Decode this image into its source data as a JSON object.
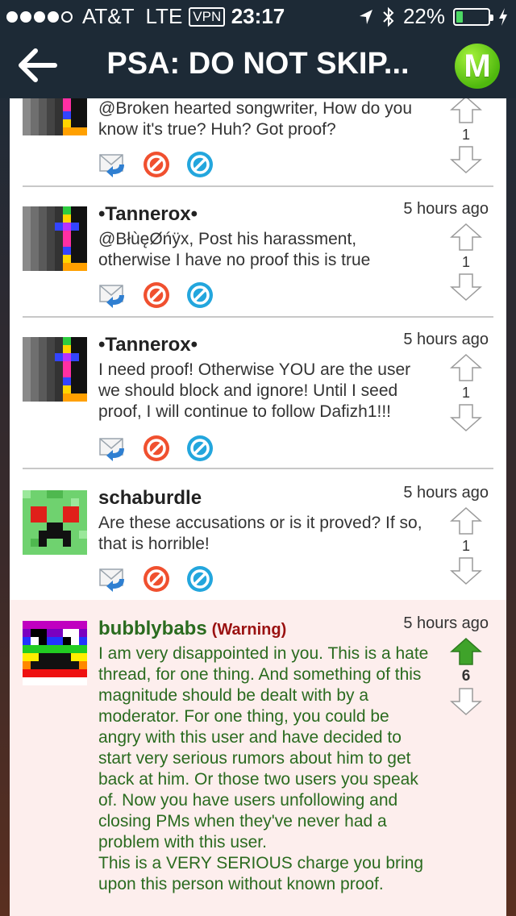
{
  "status_bar": {
    "carrier": "AT&T",
    "network": "LTE",
    "vpn": "VPN",
    "time": "23:17",
    "battery": "22%",
    "battery_level": 0.22
  },
  "nav": {
    "title": "PSA: DO NOT SKIP...",
    "logo_letter": "M"
  },
  "colors": {
    "bar": "#1d2a36",
    "upvote_active": "#3fa32a",
    "warning_bg": "#fdeeed",
    "green_text": "#2a6b1f",
    "warning_label": "#9a1111"
  },
  "comments": [
    {
      "username": "",
      "time": "",
      "text": "@Broken hearted songwriter, How do you know it's true? Huh? Got proof?",
      "votes": "1",
      "avatar": "gray-cross"
    },
    {
      "username": "•Tannerox•",
      "time": "5 hours ago",
      "text": "@BłùęØńÿx, Post his harassment, otherwise I have no proof this is true",
      "votes": "1",
      "avatar": "gray-cross"
    },
    {
      "username": "•Tannerox•",
      "time": "5 hours ago",
      "text": "I need proof! Otherwise YOU are the user we should block and ignore! Until I seed proof, I will continue to follow Dafizh1!!!",
      "votes": "1",
      "avatar": "gray-cross"
    },
    {
      "username": "schaburdle",
      "time": "5 hours ago",
      "text": "Are these accusations or is it proved? If so, that is horrible!",
      "votes": "1",
      "avatar": "creeper"
    },
    {
      "username": "bubblybabs",
      "warning": "(Warning)",
      "time": "5 hours ago",
      "text": "I am very disappointed in you. This is a hate thread, for one thing. And something of this magnitude should be dealt with by a moderator. For one thing, you could be angry with this user and have decided to start very serious rumors about him to get back at him. Or those two users you speak of. Now you have users unfollowing and closing PMs when they've never had a problem with this user.\nThis is a VERY SERIOUS charge you bring upon this person without known proof.",
      "votes": "6",
      "avatar": "rainbow"
    }
  ],
  "action_icons": [
    "reply-icon",
    "block-icon",
    "flag-icon"
  ]
}
